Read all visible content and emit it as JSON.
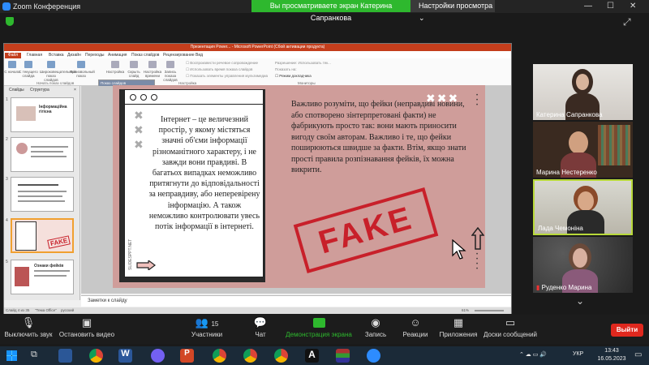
{
  "zoom": {
    "window_title": "Zoom Конференция",
    "share_banner": "Вы просматриваете экран Катерина Сапранкова",
    "view_settings": "Настройки просмотра",
    "win_min": "—",
    "win_max": "☐",
    "win_close": "✕"
  },
  "ppt": {
    "window_title": "Презентация Power... - Microsoft PowerPoint (Сбой активации продукта)",
    "tabs": [
      "Файл",
      "Главная",
      "Вставка",
      "Дизайн",
      "Переходы",
      "Анимация",
      "Показ слайдов",
      "Рецензирование",
      "Вид"
    ],
    "ribbon": {
      "buttons": [
        {
          "label": "С начала"
        },
        {
          "label": "С текущего слайда"
        },
        {
          "label": "Широковещательный показ слайдов"
        },
        {
          "label": "Произвольный показ"
        },
        {
          "label": "Настройка"
        },
        {
          "label": "Скрыть слайд"
        },
        {
          "label": "Настройка времени"
        },
        {
          "label": "Запись показа слайдов"
        }
      ],
      "checks": [
        "Воспроизвести речевое сопровождение",
        "Использовать время показа слайдов",
        "Показать элементы управления мультимедиа"
      ],
      "monitor_checks": [
        "Разрешение: Использовать тек...",
        "Показать на:",
        "Режим докладчика"
      ],
      "group_start": "Начать показ слайдов",
      "group_setup": "Настройка",
      "group_monitors": "Мониторы"
    },
    "dropdown": {
      "selected": "Показ слайдов",
      "item": "Продолжить показ слайдов"
    },
    "pane_tabs": [
      "Слайды",
      "Структура"
    ],
    "thumbnails": [
      {
        "num": "1",
        "title": "Інформаційна гігієна"
      },
      {
        "num": "2",
        "title": ""
      },
      {
        "num": "3",
        "title": ""
      },
      {
        "num": "4",
        "title": "FAKE"
      },
      {
        "num": "5",
        "title": "Ознаки фейків"
      }
    ],
    "notes_placeholder": "Заметки к слайду",
    "status": {
      "slide_info": "Слайд 4 из 35",
      "theme": "\"Тема Office\"",
      "lang": "русский",
      "zoom": "61%"
    }
  },
  "slide": {
    "card_text": "Інтернет – це величезний простір, у якому містяться значні об'єми інформації різноманітного характеру, і не завжди вони правдиві. В багатьох випадках неможливо притягнути до відповідальності за неправдиву, або неперевірену інформацію. А також неможливо контролювати увесь потік інформації в інтернеті.",
    "right_text": "Важливо розуміти, що фейки (неправдиві новини, або спотворено зінтерпретовані факти) не фабрикують просто так: вони мають приносити вигоду своїм авторам. Важливо і те, що фейки поширюються швидше за факти. Втім, якщо знати прості правила розпізнавання фейків, їх можна викрити.",
    "stamp": "FAKE",
    "vertical_url": "SLIDESPPT.NET",
    "colors": {
      "background": "#cf9d9a",
      "stamp": "#c8202a"
    }
  },
  "participants": [
    {
      "name": "Катерина Сапранкова"
    },
    {
      "name": "Марина Нестеренко"
    },
    {
      "name": "Лада Чемоніна"
    },
    {
      "name": "Руденко Марина"
    }
  ],
  "controls": {
    "mute": "Выключить звук",
    "video": "Остановить видео",
    "participants": "Участники",
    "participants_count": "15",
    "chat": "Чат",
    "share": "Демонстрация экрана",
    "record": "Запись",
    "reactions": "Реакции",
    "apps": "Приложения",
    "whiteboards": "Доски сообщений",
    "leave": "Выйти"
  },
  "taskbar": {
    "lang": "УКР",
    "time": "13:43",
    "date": "16.05.2023"
  }
}
